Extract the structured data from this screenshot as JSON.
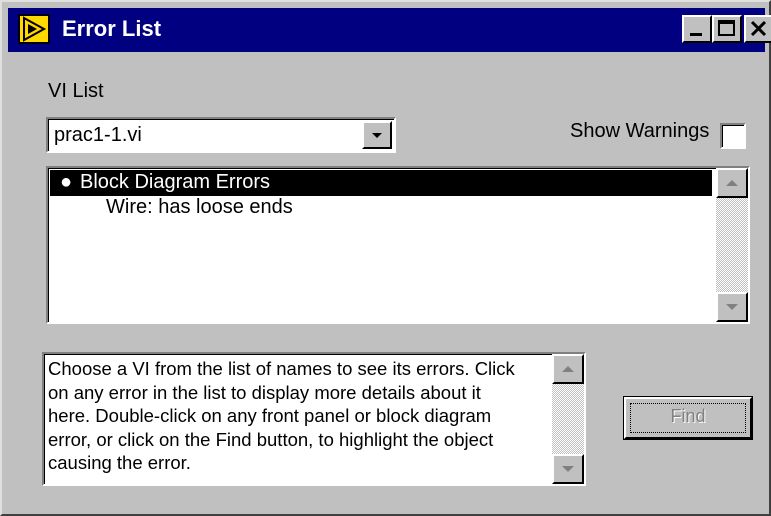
{
  "window": {
    "title": "Error List",
    "app_icon": "labview-run-icon",
    "controls": {
      "minimize": "minimize-icon",
      "maximize": "maximize-icon",
      "close": "close-icon"
    }
  },
  "vi_list": {
    "label": "VI List",
    "selected": "prac1-1.vi"
  },
  "show_warnings": {
    "label": "Show Warnings",
    "checked": false
  },
  "errors": {
    "items": [
      {
        "bullet": "●",
        "label": "Block Diagram Errors",
        "selected": true
      },
      {
        "label": "Wire: has loose ends",
        "selected": false
      }
    ]
  },
  "details": {
    "lines": [
      "Choose a VI from the list of names to see its errors. Click",
      "on any error in the list to display more details about it",
      "here. Double-click on any front panel or block diagram",
      "error, or click on the Find button, to highlight the object",
      "causing the error."
    ]
  },
  "find_button": {
    "label": "Find",
    "enabled": false
  },
  "colors": {
    "titlebar": "#000080",
    "face": "#c0c0c0",
    "selection": "#000000",
    "icon_yellow": "#ffd800"
  }
}
